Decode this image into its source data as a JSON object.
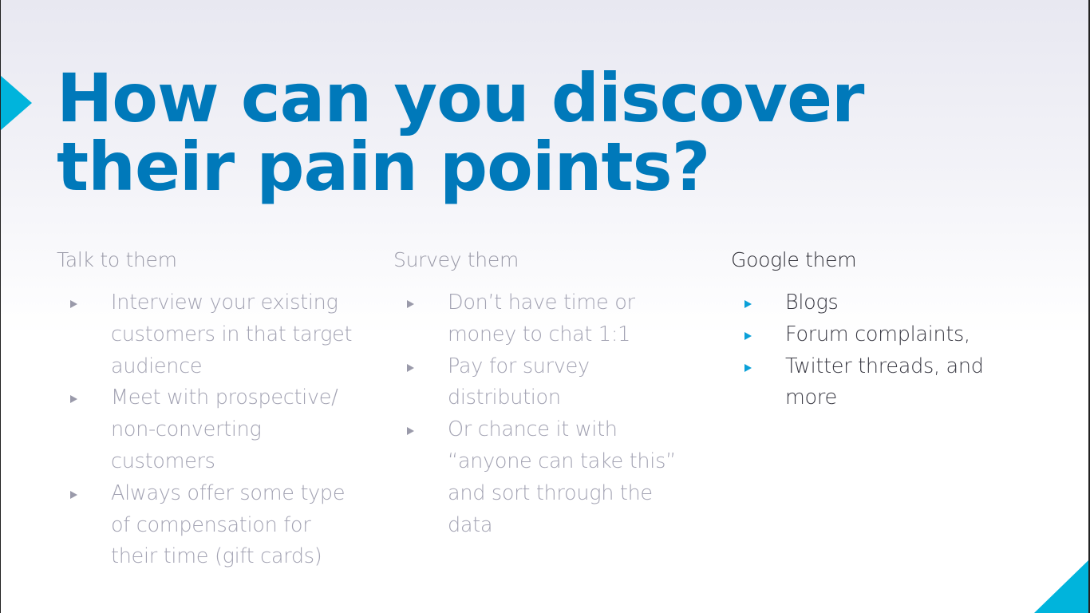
{
  "slide": {
    "title_lines": [
      "How can you discover",
      "their pain points?"
    ],
    "colors": {
      "title": "#0079ba",
      "accent": "#00b4dc",
      "muted_text": "#a3a3b3",
      "active_text": "#3a3a44",
      "active_bullet": "#0aa0d8"
    },
    "columns": [
      {
        "heading": "Talk to them",
        "items": [
          "Interview your existing customers in that target audience",
          "Meet with prospective/ non-converting customers",
          "Always offer some type of compensation for their time (gift cards)"
        ]
      },
      {
        "heading": "Survey them",
        "items": [
          "Don’t have time or money to chat 1:1",
          "Pay for survey distribution",
          "Or chance it with “anyone can take this” and sort through the data"
        ]
      },
      {
        "heading": "Google them",
        "items": [
          "Blogs",
          "Forum complaints,",
          "Twitter threads, and more"
        ]
      }
    ]
  }
}
